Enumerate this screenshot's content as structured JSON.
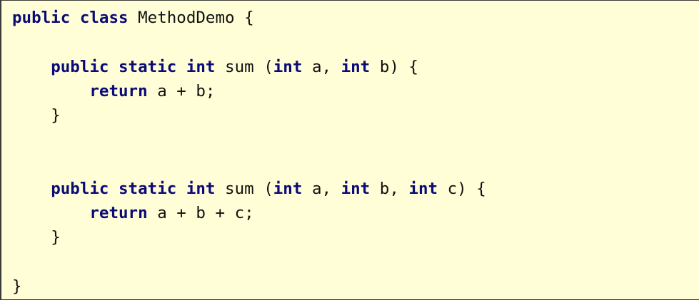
{
  "code": {
    "language": "Java",
    "keyword_color": "#0b0b78",
    "background_color": "#fffed6",
    "lines": [
      {
        "indent": "",
        "tokens": [
          {
            "type": "kw",
            "text": "public"
          },
          {
            "type": "id",
            "text": " "
          },
          {
            "type": "kw",
            "text": "class"
          },
          {
            "type": "id",
            "text": " MethodDemo {"
          }
        ]
      },
      {
        "indent": "",
        "tokens": []
      },
      {
        "indent": "    ",
        "tokens": [
          {
            "type": "kw",
            "text": "public"
          },
          {
            "type": "id",
            "text": " "
          },
          {
            "type": "kw",
            "text": "static"
          },
          {
            "type": "id",
            "text": " "
          },
          {
            "type": "kw",
            "text": "int"
          },
          {
            "type": "id",
            "text": " sum ("
          },
          {
            "type": "kw",
            "text": "int"
          },
          {
            "type": "id",
            "text": " a, "
          },
          {
            "type": "kw",
            "text": "int"
          },
          {
            "type": "id",
            "text": " b) {"
          }
        ]
      },
      {
        "indent": "        ",
        "tokens": [
          {
            "type": "kw",
            "text": "return"
          },
          {
            "type": "id",
            "text": " a + b;"
          }
        ]
      },
      {
        "indent": "    ",
        "tokens": [
          {
            "type": "id",
            "text": "}"
          }
        ]
      },
      {
        "indent": "",
        "tokens": []
      },
      {
        "indent": "",
        "tokens": []
      },
      {
        "indent": "    ",
        "tokens": [
          {
            "type": "kw",
            "text": "public"
          },
          {
            "type": "id",
            "text": " "
          },
          {
            "type": "kw",
            "text": "static"
          },
          {
            "type": "id",
            "text": " "
          },
          {
            "type": "kw",
            "text": "int"
          },
          {
            "type": "id",
            "text": " sum ("
          },
          {
            "type": "kw",
            "text": "int"
          },
          {
            "type": "id",
            "text": " a, "
          },
          {
            "type": "kw",
            "text": "int"
          },
          {
            "type": "id",
            "text": " b, "
          },
          {
            "type": "kw",
            "text": "int"
          },
          {
            "type": "id",
            "text": " c) {"
          }
        ]
      },
      {
        "indent": "        ",
        "tokens": [
          {
            "type": "kw",
            "text": "return"
          },
          {
            "type": "id",
            "text": " a + b + c;"
          }
        ]
      },
      {
        "indent": "    ",
        "tokens": [
          {
            "type": "id",
            "text": "}"
          }
        ]
      },
      {
        "indent": "",
        "tokens": []
      },
      {
        "indent": "",
        "tokens": [
          {
            "type": "id",
            "text": "}"
          }
        ]
      }
    ]
  }
}
